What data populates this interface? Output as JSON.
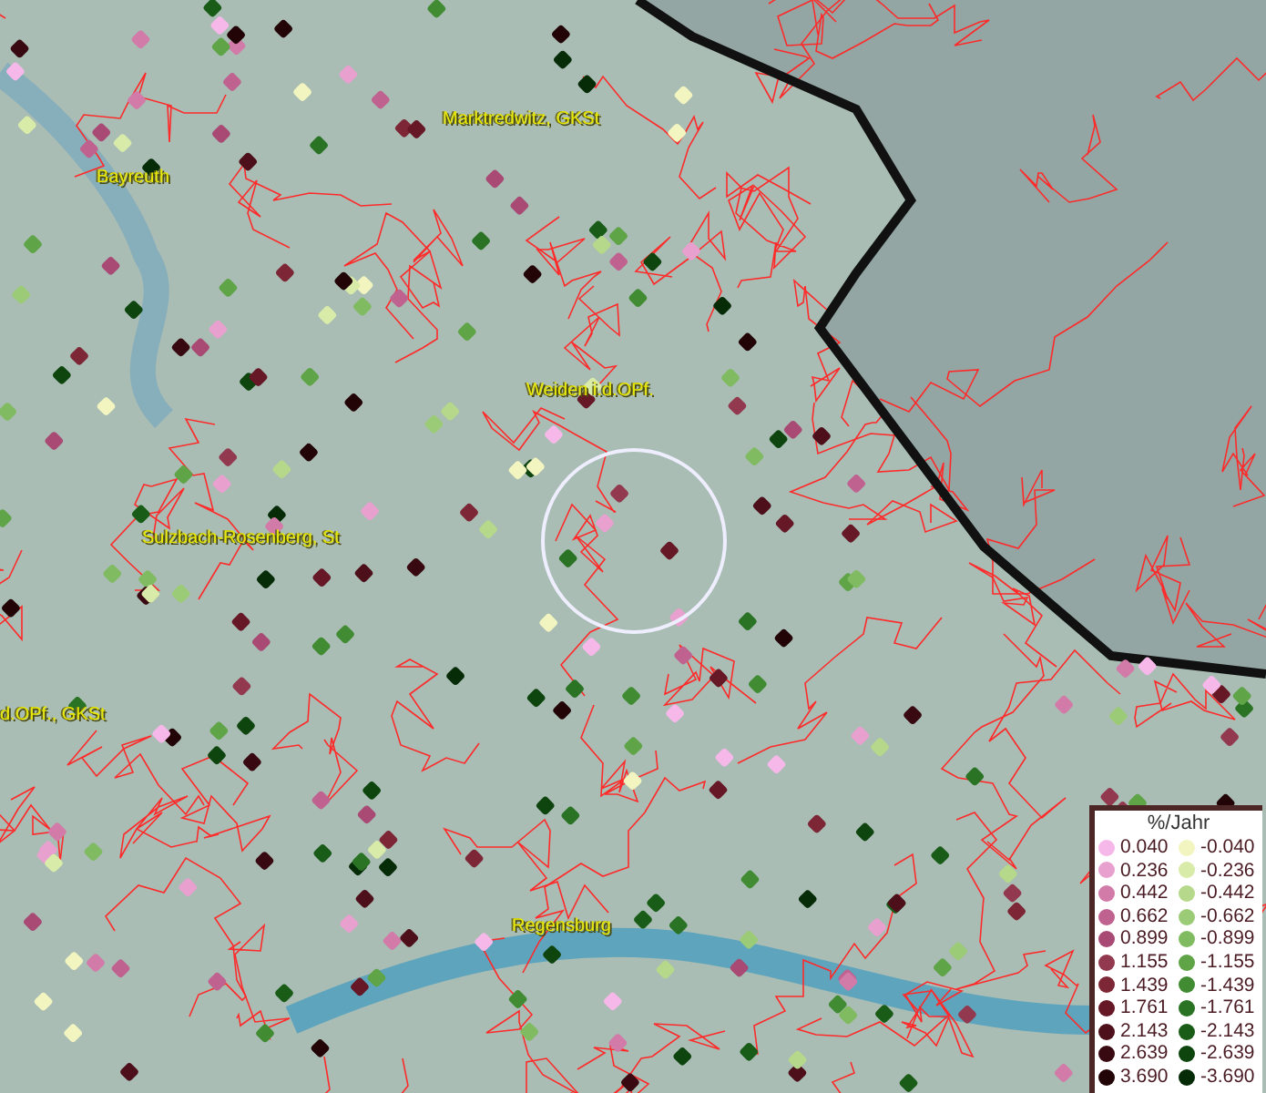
{
  "map": {
    "places": [
      {
        "name": "Marktredwitz, GKSt"
      },
      {
        "name": "Bayreuth"
      },
      {
        "name": "Weiden i.d.OPf."
      },
      {
        "name": "Sulzbach-Rosenberg, St"
      },
      {
        "name": "d.OPf., GKSt"
      },
      {
        "name": "Regensburg"
      }
    ]
  },
  "legend": {
    "title": "%/Jahr",
    "rows": [
      {
        "positive": {
          "value": "0.040",
          "color": "#f5b8e8"
        },
        "negative": {
          "value": "-0.040",
          "color": "#f2f5c0"
        }
      },
      {
        "positive": {
          "value": "0.236",
          "color": "#e8a0cf"
        },
        "negative": {
          "value": "-0.236",
          "color": "#d8eba8"
        }
      },
      {
        "positive": {
          "value": "0.442",
          "color": "#d27aa8"
        },
        "negative": {
          "value": "-0.442",
          "color": "#b5d88a"
        }
      },
      {
        "positive": {
          "value": "0.662",
          "color": "#c0628f"
        },
        "negative": {
          "value": "-0.662",
          "color": "#9ccb78"
        }
      },
      {
        "positive": {
          "value": "0.899",
          "color": "#a84a73"
        },
        "negative": {
          "value": "-0.899",
          "color": "#80bb62"
        }
      },
      {
        "positive": {
          "value": "1.155",
          "color": "#93394f"
        },
        "negative": {
          "value": "-1.155",
          "color": "#5fa447"
        }
      },
      {
        "positive": {
          "value": "1.439",
          "color": "#7d2636"
        },
        "negative": {
          "value": "-1.439",
          "color": "#418c33"
        }
      },
      {
        "positive": {
          "value": "1.761",
          "color": "#661826"
        },
        "negative": {
          "value": "-1.761",
          "color": "#2a7324"
        }
      },
      {
        "positive": {
          "value": "2.143",
          "color": "#4d0f1a"
        },
        "negative": {
          "value": "-2.143",
          "color": "#195c17"
        }
      },
      {
        "positive": {
          "value": "2.639",
          "color": "#380910"
        },
        "negative": {
          "value": "-2.639",
          "color": "#0e450e"
        }
      },
      {
        "positive": {
          "value": "3.690",
          "color": "#220406"
        },
        "negative": {
          "value": "-3.690",
          "color": "#062b07"
        }
      }
    ]
  }
}
